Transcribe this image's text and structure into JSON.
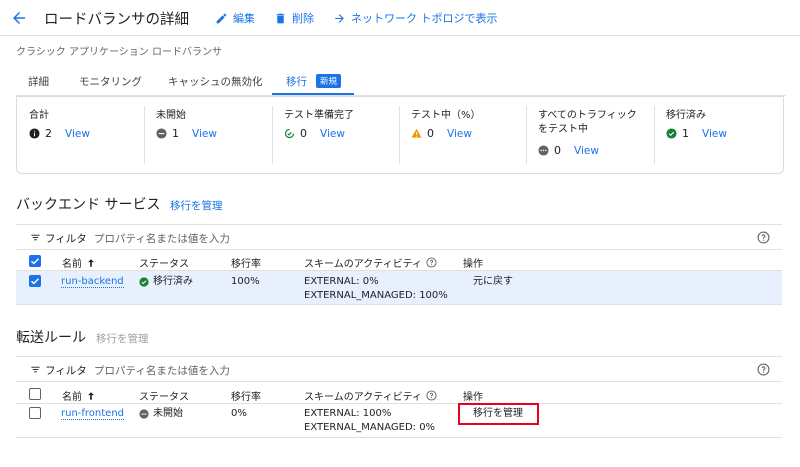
{
  "header": {
    "title": "ロードバランサの詳細",
    "edit_label": "編集",
    "delete_label": "削除",
    "topology_label": "ネットワーク トポロジで表示"
  },
  "subtitle": "クラシック アプリケーション ロードバランサ",
  "tabs": [
    {
      "label": "詳細"
    },
    {
      "label": "モニタリング"
    },
    {
      "label": "キャッシュの無効化"
    },
    {
      "label": "移行"
    }
  ],
  "new_badge": "新規",
  "summary": [
    {
      "title": "合計",
      "count": "2",
      "view": "View",
      "icon": "info-icon"
    },
    {
      "title": "未開始",
      "count": "1",
      "view": "View",
      "icon": "minus-circle-icon"
    },
    {
      "title": "テスト準備完了",
      "count": "0",
      "view": "View",
      "icon": "refresh-check-icon"
    },
    {
      "title": "テスト中（%）",
      "count": "0",
      "view": "View",
      "icon": "warning-icon"
    },
    {
      "title_line1": "すべてのトラフィック",
      "title_line2": "をテスト中",
      "count": "0",
      "view": "View",
      "icon": "more-circle-icon"
    },
    {
      "title": "移行済み",
      "count": "1",
      "view": "View",
      "icon": "check-circle-icon"
    }
  ],
  "backend": {
    "title": "バックエンド サービス",
    "manage_label": "移行を管理",
    "filter_label": "フィルタ",
    "filter_placeholder": "プロパティ名または値を入力",
    "columns": [
      "名前",
      "ステータス",
      "移行率",
      "スキームのアクティビティ",
      "操作"
    ],
    "rows": [
      {
        "name": "run-backend",
        "status": "移行済み",
        "rate": "100%",
        "scheme1": "EXTERNAL: 0%",
        "scheme2": "EXTERNAL_MANAGED: 100%",
        "action": "元に戻す"
      }
    ]
  },
  "forwarding": {
    "title": "転送ルール",
    "manage_label": "移行を管理",
    "filter_label": "フィルタ",
    "filter_placeholder": "プロパティ名または値を入力",
    "columns": [
      "名前",
      "ステータス",
      "移行率",
      "スキームのアクティビティ",
      "操作"
    ],
    "rows": [
      {
        "name": "run-frontend",
        "status": "未開始",
        "rate": "0%",
        "scheme1": "EXTERNAL: 100%",
        "scheme2": "EXTERNAL_MANAGED: 0%",
        "action": "移行を管理"
      }
    ]
  },
  "colors": {
    "accent": "#1a73e8",
    "highlight": "#e8001c",
    "selected_row": "#e8f0fe",
    "success": "#188038",
    "warning": "#f29900"
  }
}
